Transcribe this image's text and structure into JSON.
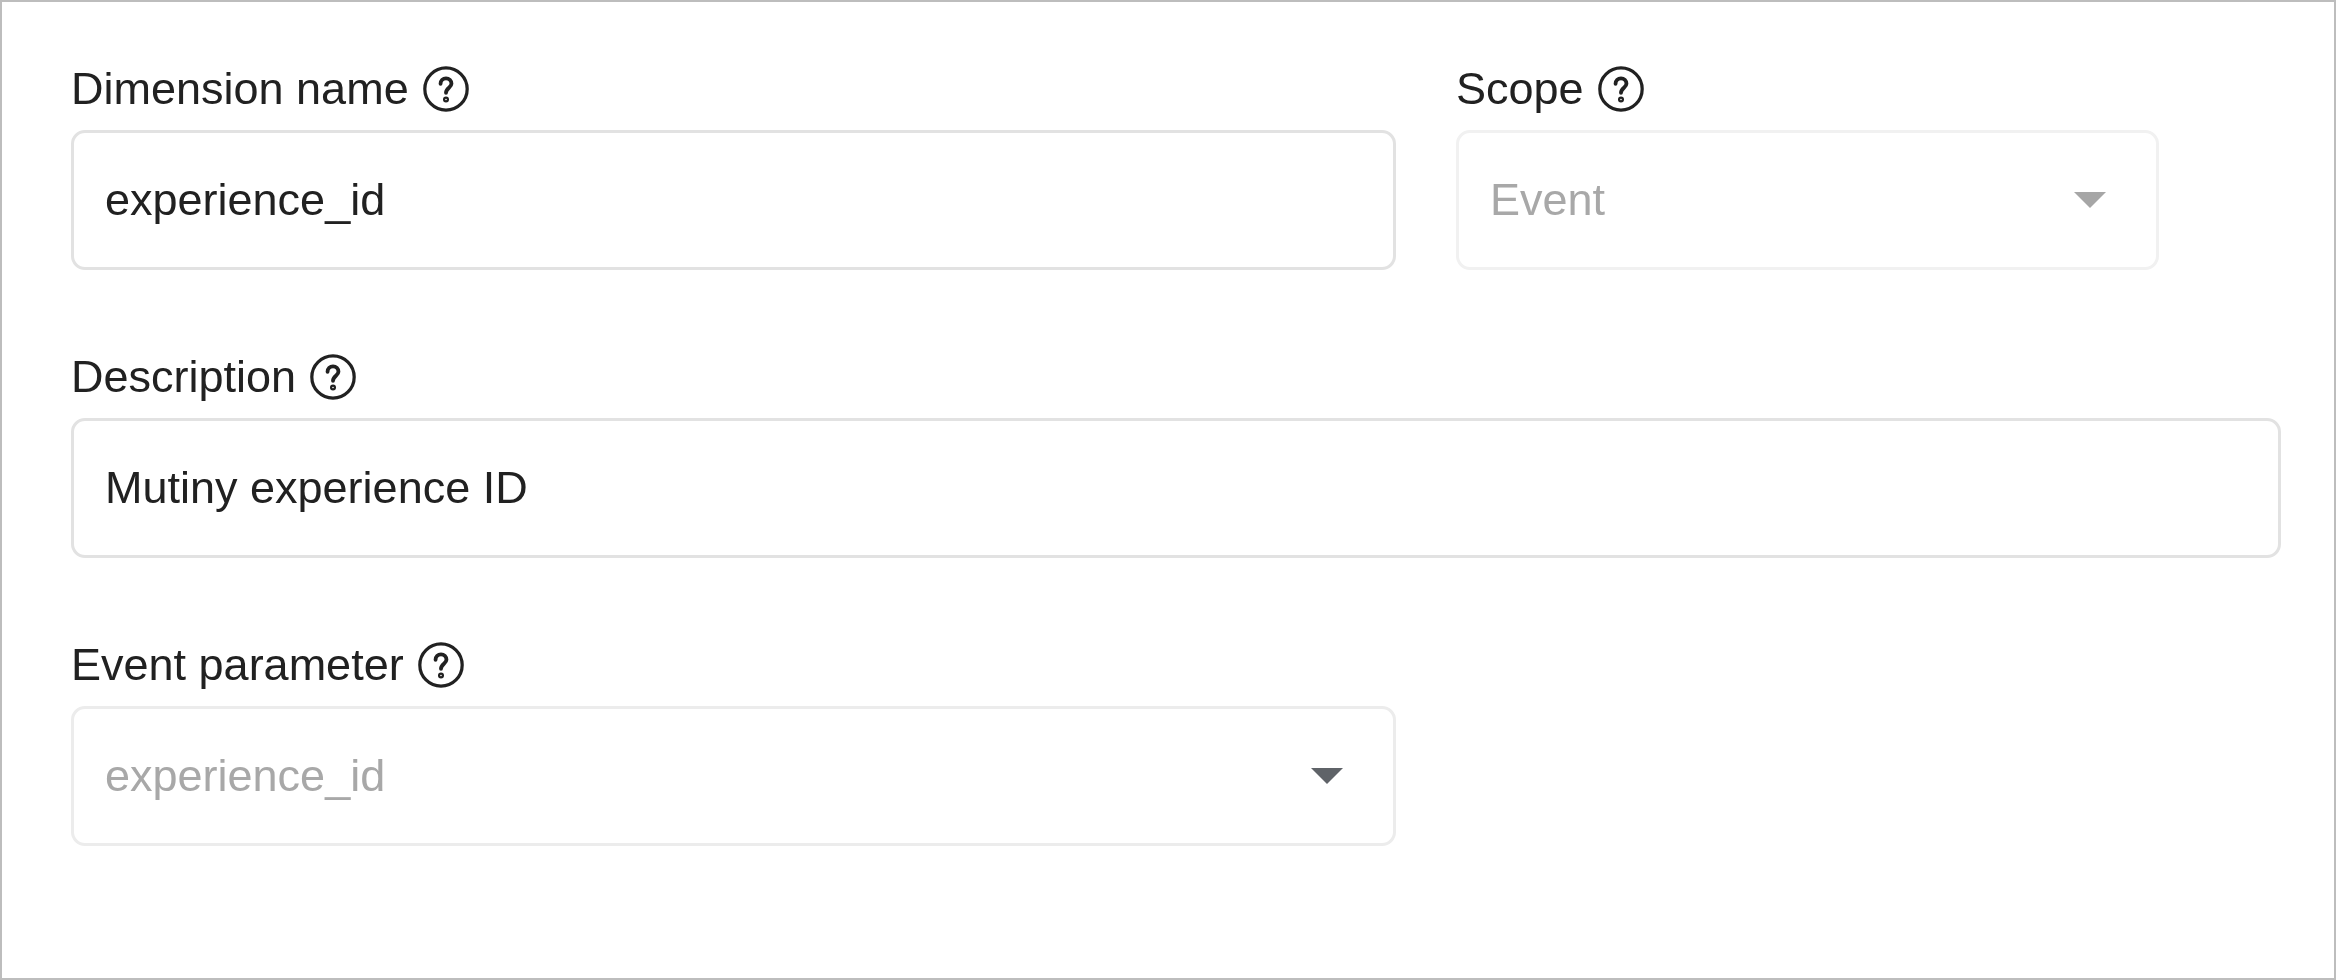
{
  "fields": [
    {
      "kind": "text",
      "label": "Dimension name",
      "value": "experience_id",
      "disabled": false
    },
    {
      "kind": "select",
      "label": "Scope",
      "value": "Event",
      "disabled": true
    },
    {
      "kind": "text",
      "label": "Description",
      "value": "Mutiny experience ID",
      "disabled": false
    },
    {
      "kind": "select",
      "label": "Event parameter",
      "placeholder": "experience_id",
      "disabled": false
    }
  ]
}
